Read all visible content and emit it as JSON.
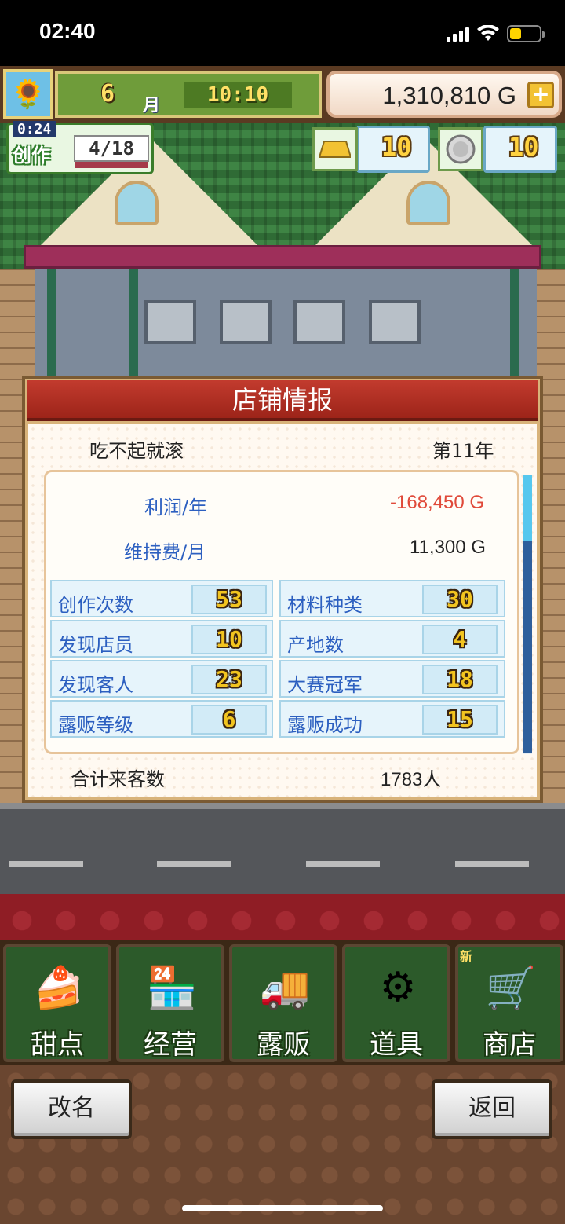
{
  "status_bar": {
    "time": "02:40",
    "battery_level": 0.4
  },
  "hud": {
    "month": "6",
    "month_unit": "月",
    "clock": "10:10",
    "money": "1,310,810 G",
    "create": {
      "timer": "0:24",
      "label": "创作",
      "count": "4/18"
    },
    "gold_bars": "10",
    "medals": "10"
  },
  "dialog": {
    "title": "店铺情报",
    "shop_name": "吃不起就滚",
    "year": "第11年",
    "profit_label": "利润/年",
    "profit_value": "-168,450 G",
    "upkeep_label": "维持费/月",
    "upkeep_value": "11,300 G",
    "stats_left": [
      {
        "label": "创作次数",
        "value": "53"
      },
      {
        "label": "发现店员",
        "value": "10"
      },
      {
        "label": "发现客人",
        "value": "23"
      },
      {
        "label": "露贩等级",
        "value": "6"
      }
    ],
    "stats_right": [
      {
        "label": "材料种类",
        "value": "30"
      },
      {
        "label": "产地数",
        "value": "4"
      },
      {
        "label": "大赛冠军",
        "value": "18"
      },
      {
        "label": "露贩成功",
        "value": "15"
      }
    ],
    "total_label": "合计来客数",
    "total_value": "1783人"
  },
  "menu": [
    {
      "label": "甜点",
      "icon": "cake-icon"
    },
    {
      "label": "经营",
      "icon": "shop-icon"
    },
    {
      "label": "露贩",
      "icon": "food-truck-icon"
    },
    {
      "label": "道具",
      "icon": "items-icon"
    },
    {
      "label": "商店",
      "icon": "cart-icon",
      "badge": "新"
    }
  ],
  "actions": {
    "rename": "改名",
    "back": "返回"
  },
  "colors": {
    "title_red": "#c23b2e",
    "stat_blue": "#2c5fc0",
    "negative": "#e04a3a",
    "menu_green": "#2c5a2a"
  }
}
